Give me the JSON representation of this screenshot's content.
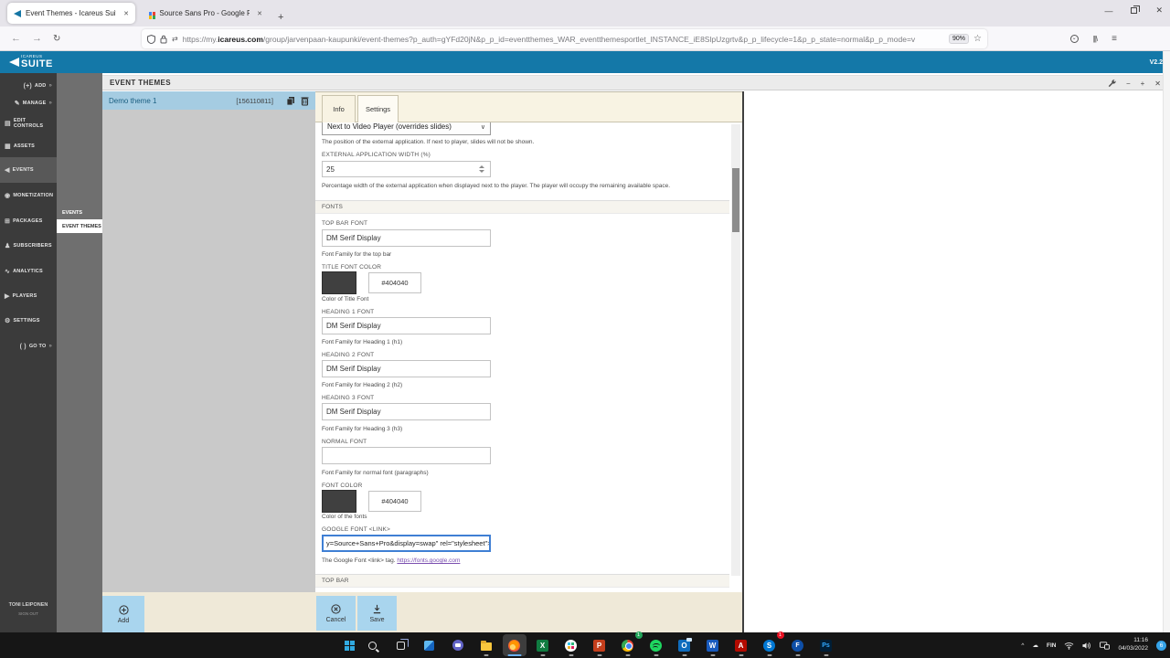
{
  "browser": {
    "tab1": "Event Themes - Icareus Suite",
    "tab2": "Source Sans Pro - Google Fonts",
    "url_prefix": "https://my.",
    "url_domain": "icareus.com",
    "url_path": "/group/jarvenpaan-kaupunki/event-themes?p_auth=gYFd20jN&p_p_id=eventthemes_WAR_eventthemesportlet_INSTANCE_iE8SlpUzgrtv&p_p_lifecycle=1&p_p_state=normal&p_p_mode=v",
    "zoom_badge": "90%",
    "glyphs": {
      "close": "✕",
      "new_tab": "+",
      "back": "←",
      "forward": "→",
      "reload": "↻",
      "star": "☆",
      "menu": "≡",
      "switch": "⇄",
      "minimize": "—",
      "lib": "|||\\"
    }
  },
  "header": {
    "logo_small": "ICAREUS",
    "logo_large": "SUITE",
    "version": "V2.2"
  },
  "sidebar": {
    "items": [
      {
        "icon": "(+)",
        "label": "ADD",
        "chevron": "»"
      },
      {
        "icon": "✎",
        "label": "MANAGE",
        "chevron": "»"
      },
      {
        "icon": "▤",
        "label": "EDIT CONTROLS",
        "chevron": ""
      },
      {
        "icon": "▦",
        "label": "ASSETS",
        "chevron": ""
      },
      {
        "icon": "◀",
        "label": "EVENTS",
        "chevron": ""
      },
      {
        "icon": "◉",
        "label": "MONETIZATION",
        "chevron": ""
      },
      {
        "icon": "⊞",
        "label": "PACKAGES",
        "chevron": ""
      },
      {
        "icon": "♟",
        "label": "SUBSCRIBERS",
        "chevron": ""
      },
      {
        "icon": "∿",
        "label": "ANALYTICS",
        "chevron": ""
      },
      {
        "icon": "▶",
        "label": "PLAYERS",
        "chevron": ""
      },
      {
        "icon": "⚙",
        "label": "SETTINGS",
        "chevron": ""
      },
      {
        "icon": "( )",
        "label": "GO TO",
        "chevron": "»"
      }
    ],
    "user_name": "TONI LEIPONEN",
    "sign_out": "SIGN OUT",
    "submenu": {
      "events": "EVENTS",
      "event_themes": "EVENT THEMES"
    }
  },
  "page": {
    "title": "EVENT THEMES",
    "portlet_glyphs": {
      "minus": "−",
      "plus": "+",
      "close": "✕"
    },
    "theme": {
      "name": "Demo theme 1",
      "id": "[156110811]"
    }
  },
  "panel": {
    "tab_info": "Info",
    "tab_settings": "Settings",
    "select_value": "Next to Video Player (overrides slides)",
    "select_chevron": "∨",
    "select_help": "The position of the external application. If next to player, slides will not be shown.",
    "width_label": "EXTERNAL APPLICATION WIDTH (%)",
    "width_value": "25",
    "width_help": "Percentage width of the external application when displayed next to the player. The player will occupy the remaining available space.",
    "fonts_section": "FONTS",
    "fields": [
      {
        "label": "TOP BAR FONT",
        "value": "DM Serif Display",
        "help": "Font Family for the top bar"
      },
      {
        "label": "HEADING 1 FONT",
        "value": "DM Serif Display",
        "help": "Font Family for Heading 1 (h1)"
      },
      {
        "label": "HEADING 2 FONT",
        "value": "DM Serif Display",
        "help": "Font Family for Heading 2 (h2)"
      },
      {
        "label": "HEADING 3 FONT",
        "value": "DM Serif Display",
        "help": "Font Family for Heading 3 (h3)"
      },
      {
        "label": "NORMAL FONT",
        "value": "",
        "help": "Font Family for normal font (paragraphs)"
      }
    ],
    "title_color": {
      "label": "TITLE FONT COLOR",
      "value": "#404040",
      "swatch": "#404040",
      "help": "Color of Title Font"
    },
    "font_color": {
      "label": "FONT COLOR",
      "value": "#404040",
      "swatch": "#404040",
      "help": "Color of the fonts"
    },
    "google_font": {
      "label": "GOOGLE FONT <LINK>",
      "value": "y=Source+Sans+Pro&display=swap\" rel=\"stylesheet\"> ",
      "help": "The Google Font <link> tag. ",
      "link": "https://fonts.google.com"
    },
    "next_section": "TOP BAR",
    "cancel": "Cancel",
    "save": "Save",
    "add": "Add"
  },
  "taskbar": {
    "lang": "FIN",
    "time": "11:16",
    "date": "04/03/2022",
    "notif_badge": "6",
    "chrome_badge": "1",
    "skype_badge": "1",
    "tray_chevron": "^",
    "cloud": "☁",
    "glyphs": {
      "excel": "X",
      "ppt": "P",
      "outlook": "O",
      "word": "W",
      "acrobat": "A",
      "skype": "S",
      "fsecure": "F",
      "photoshop": "Ps"
    }
  }
}
